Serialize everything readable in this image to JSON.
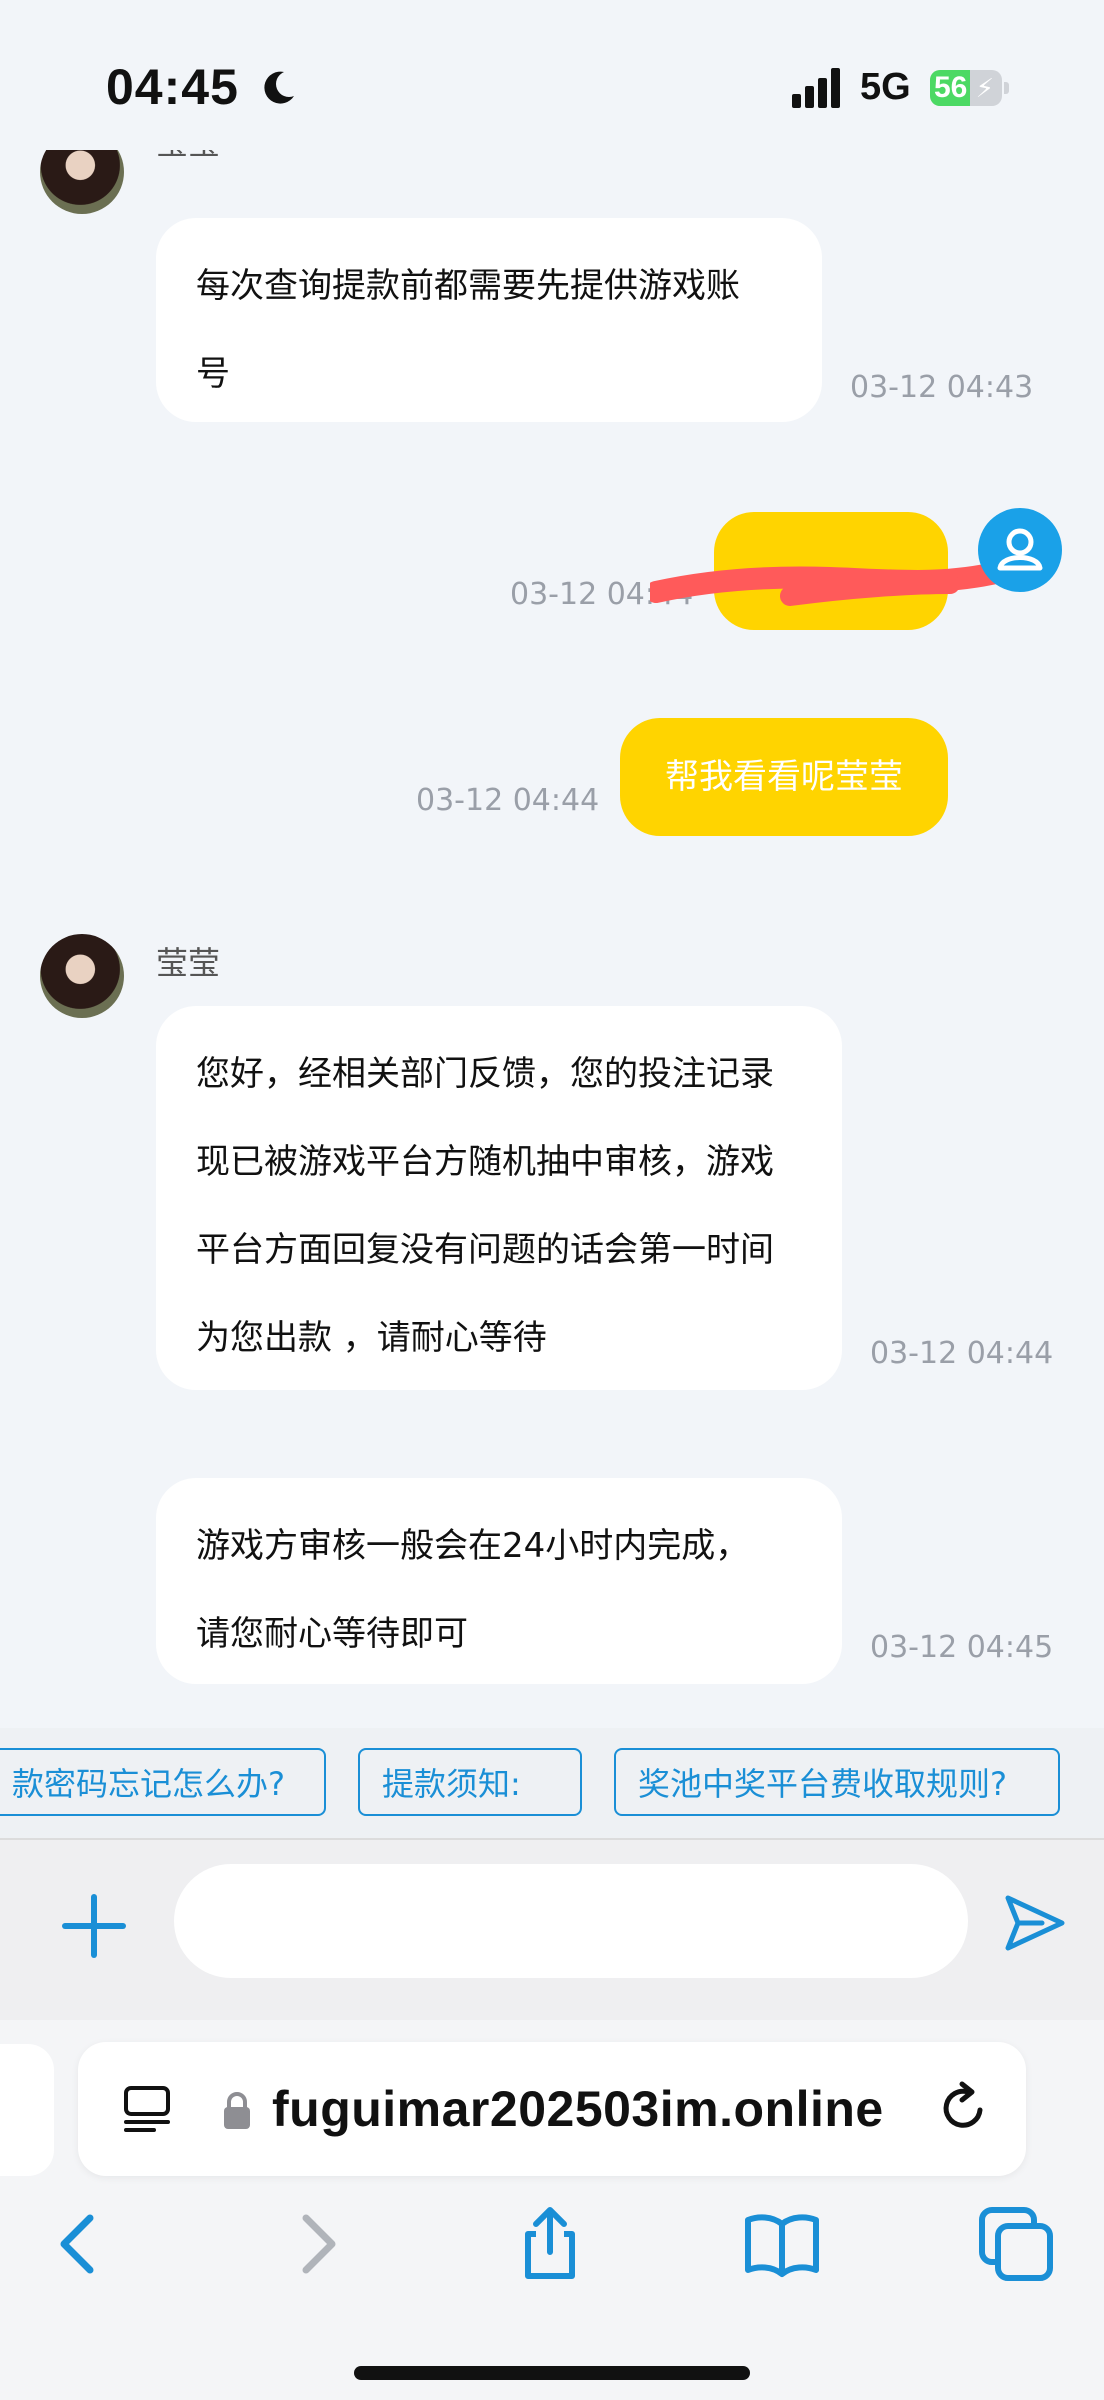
{
  "status_bar": {
    "time": "04:45",
    "network": "5G",
    "battery_level": "56"
  },
  "chat": {
    "messages": [
      {
        "from": "agent",
        "sender": "莹莹",
        "lines": [
          "每次查询提款前都需要先提供游戏账",
          "号"
        ],
        "time": "03-12 04:43"
      },
      {
        "from": "me",
        "text": "",
        "redacted": true,
        "time": "03-12 04:44"
      },
      {
        "from": "me",
        "text": "帮我看看呢莹莹",
        "time": "03-12 04:44"
      },
      {
        "from": "agent",
        "sender": "莹莹",
        "lines": [
          "您好，经相关部门反馈，您的投注记录",
          "现已被游戏平台方随机抽中审核，游戏",
          "平台方面回复没有问题的话会第一时间",
          "为您出款 ，请耐心等待"
        ],
        "time": "03-12 04:44"
      },
      {
        "from": "agent",
        "lines": [
          "游戏方审核一般会在24小时内完成，",
          "请您耐心等待即可"
        ],
        "time": "03-12 04:45"
      }
    ]
  },
  "quick_replies": [
    "款密码忘记怎么办?",
    "提款须知:",
    "奖池中奖平台费收取规则?"
  ],
  "composer": {
    "placeholder": ""
  },
  "browser": {
    "url": "fuguimar202503im.online"
  },
  "colors": {
    "accent": "#1a8fd6",
    "my_bubble": "#ffd400",
    "background": "#f2f5f9"
  },
  "icons": [
    "moon-icon",
    "signal-icon",
    "battery-icon",
    "user-avatar-icon",
    "plus-icon",
    "send-icon",
    "reader-mode-icon",
    "lock-icon",
    "reload-icon",
    "back-icon",
    "forward-icon",
    "share-icon",
    "bookmarks-icon",
    "tabs-icon"
  ]
}
